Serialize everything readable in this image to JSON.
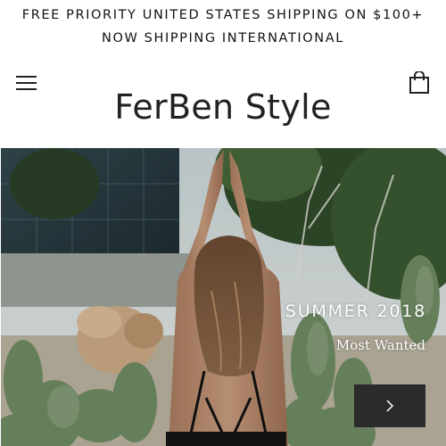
{
  "announcement": {
    "line1": "FREE PRIORITY UNITED STATES SHIPPING ON $100+",
    "line2": "NOW SHIPPING INTERNATIONAL"
  },
  "header": {
    "menu_icon": "hamburger-menu-icon",
    "cart_icon": "shopping-bag-icon",
    "logo": "FerBen Style"
  },
  "hero": {
    "title": "SUMMER 2018",
    "subtitle": "Most Wanted",
    "next_icon": "chevron-right-icon"
  }
}
